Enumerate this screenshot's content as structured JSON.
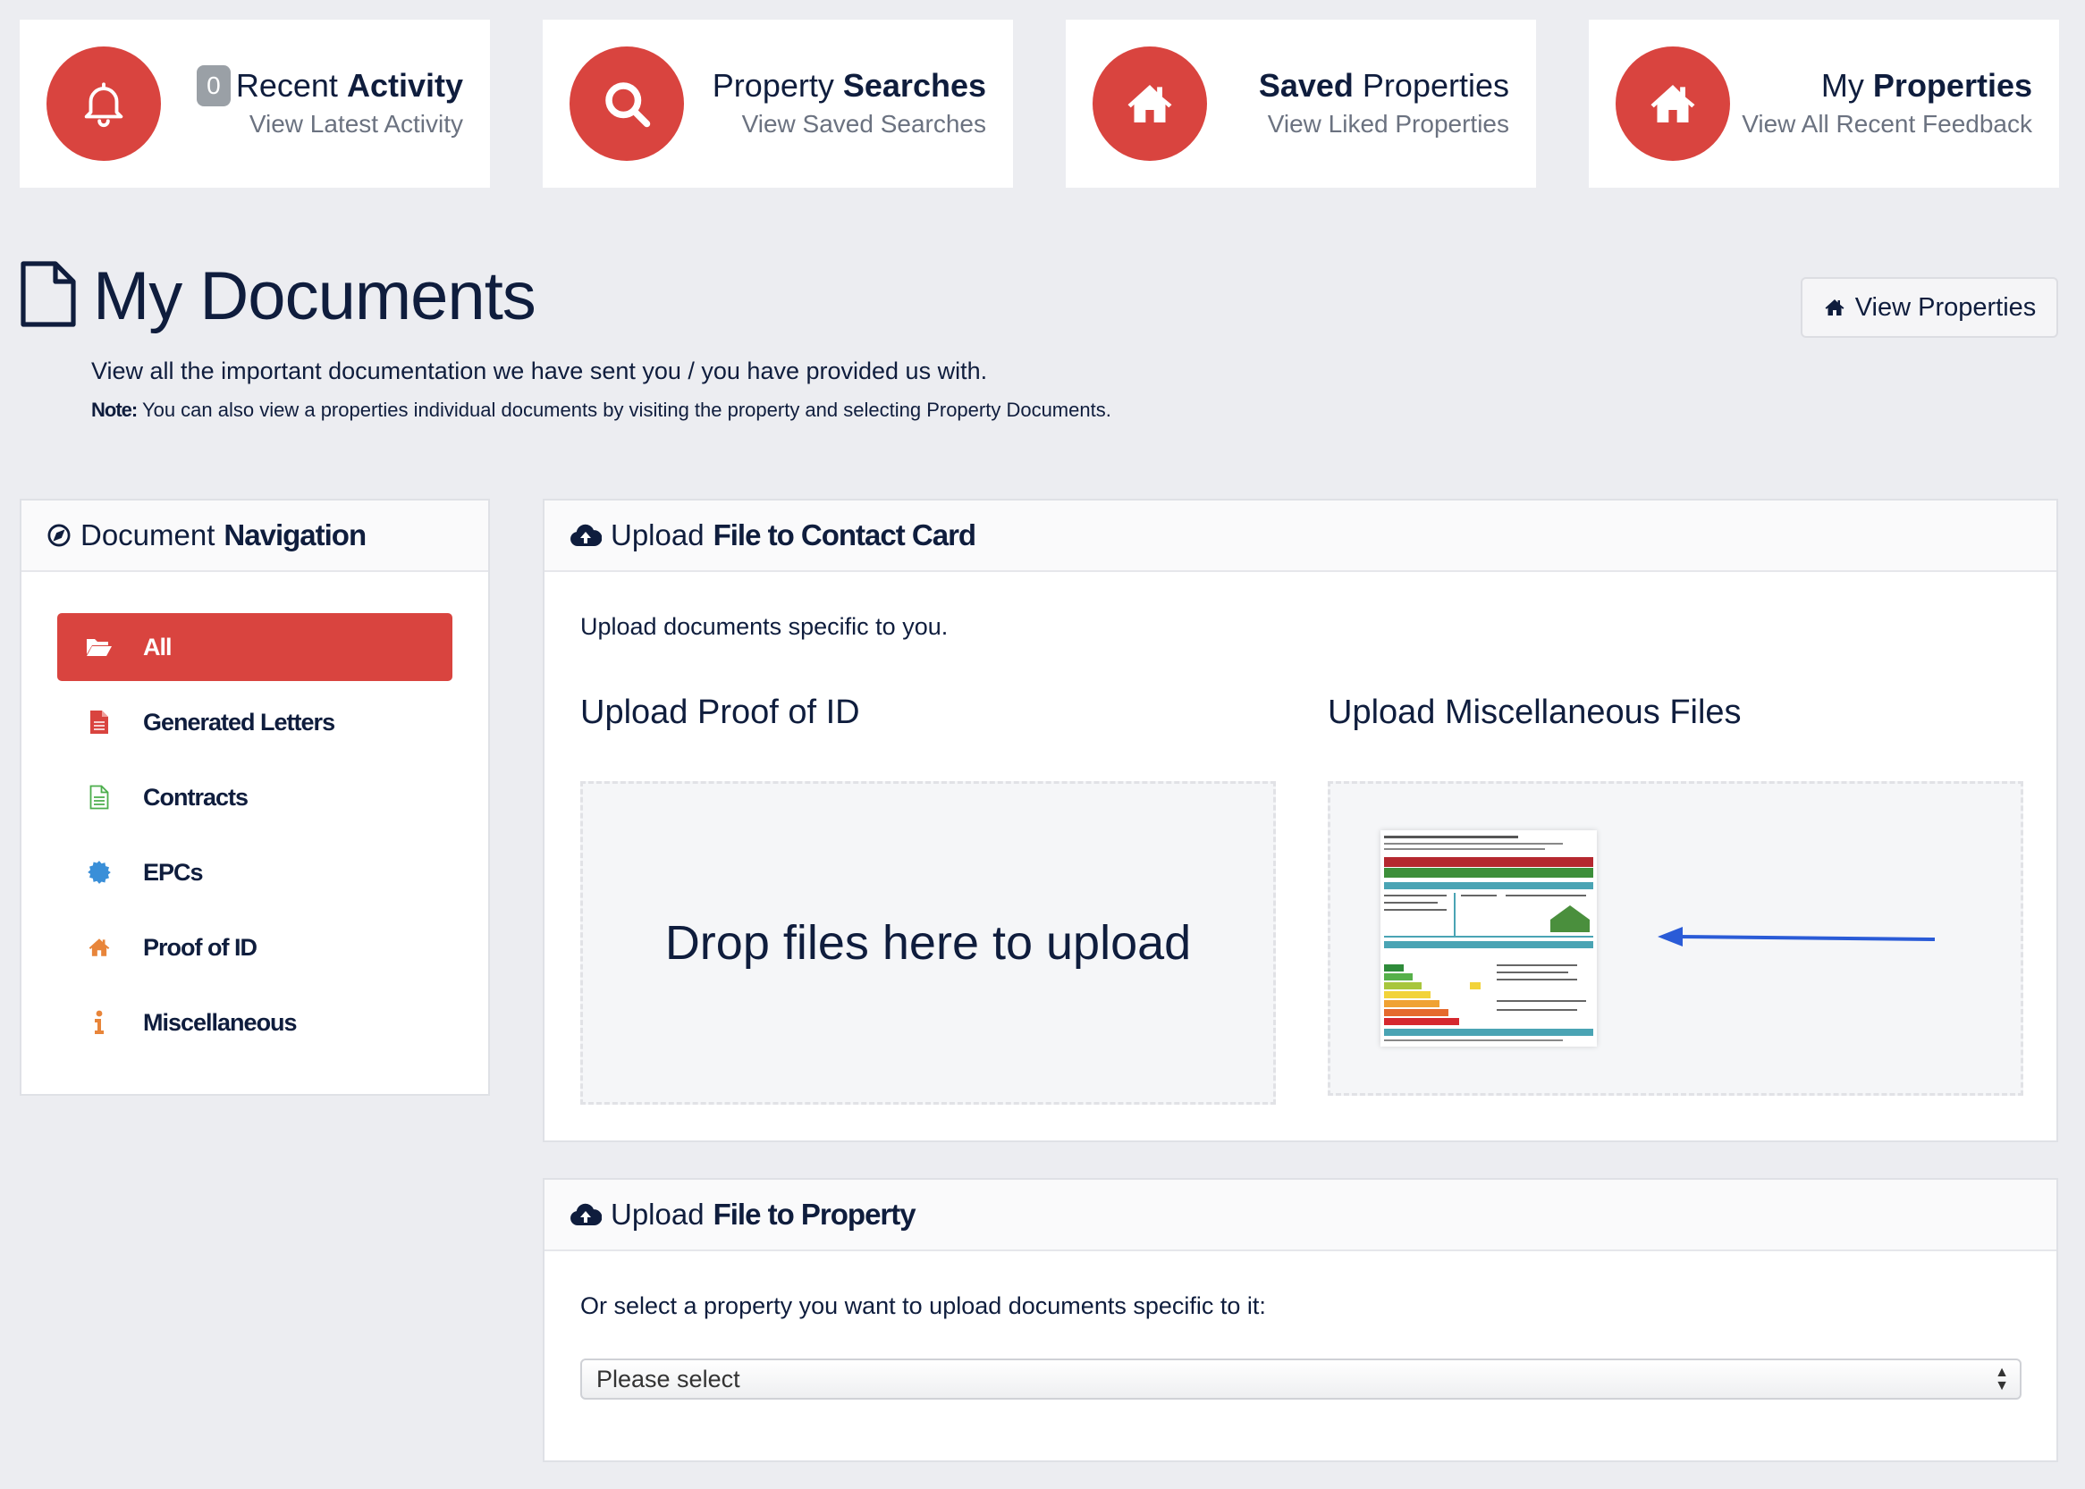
{
  "stats": [
    {
      "badge": "0",
      "title_light": "Recent",
      "title_bold": "Activity",
      "subtitle": "View Latest Activity",
      "icon": "bell-icon"
    },
    {
      "title_light": "Property",
      "title_bold": "Searches",
      "subtitle": "View Saved Searches",
      "icon": "search-icon"
    },
    {
      "title_bold": "Saved",
      "title_light": "Properties",
      "subtitle": "View Liked Properties",
      "icon": "home-icon"
    },
    {
      "title_light": "My",
      "title_bold": "Properties",
      "subtitle": "View All Recent Feedback",
      "icon": "home-icon"
    }
  ],
  "header": {
    "title": "My Documents",
    "view_properties_label": "View Properties",
    "intro": "View all the important documentation we have sent you / you have provided us with.",
    "note_label": "Note:",
    "note_text": "You can also view a properties individual documents by visiting the property and selecting Property Documents."
  },
  "nav": {
    "title_light": "Document",
    "title_bold": "Navigation",
    "items": [
      {
        "label": "All",
        "icon": "folder-open-icon",
        "color": "#ffffff"
      },
      {
        "label": "Generated Letters",
        "icon": "file-icon",
        "color": "#d9443f"
      },
      {
        "label": "Contracts",
        "icon": "file-text-icon",
        "color": "#4cae4c"
      },
      {
        "label": "EPCs",
        "icon": "certificate-icon",
        "color": "#3a8fd8"
      },
      {
        "label": "Proof of ID",
        "icon": "home-icon",
        "color": "#e8853a"
      },
      {
        "label": "Miscellaneous",
        "icon": "info-icon",
        "color": "#e8853a"
      }
    ]
  },
  "upload_contact": {
    "title_light": "Upload",
    "title_bold": "File to Contact Card",
    "description": "Upload documents specific to you.",
    "proof_label": "Upload Proof of ID",
    "misc_label": "Upload Miscellaneous Files",
    "drop_text": "Drop files here to upload"
  },
  "upload_property": {
    "title_light": "Upload",
    "title_bold": "File to Property",
    "description": "Or select a property you want to upload documents specific to it:",
    "select_value": "Please select"
  },
  "colors": {
    "accent": "#d9443f",
    "navy": "#0f1d3d",
    "background": "#ecedf1",
    "arrow": "#2a5bd7"
  }
}
